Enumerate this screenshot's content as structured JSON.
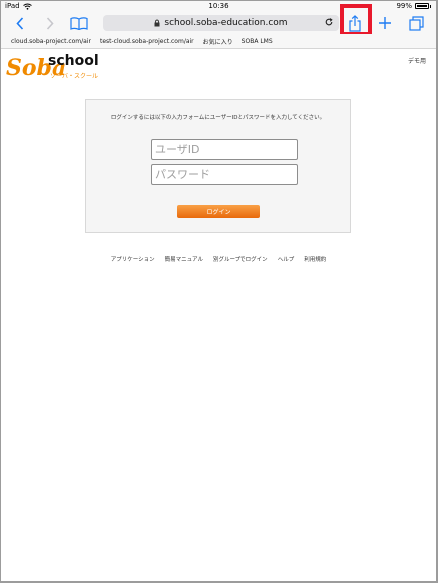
{
  "status_bar": {
    "device": "iPad",
    "time": "10:36",
    "battery": "99%"
  },
  "toolbar": {
    "url": "school.soba-education.com",
    "icons": {
      "back": "chevron-left-icon",
      "forward": "chevron-right-icon",
      "bookmarks": "book-icon",
      "reload": "reload-icon",
      "share": "share-icon",
      "new_tab": "plus-icon",
      "tabs": "tabs-icon"
    }
  },
  "bookmarks": [
    "cloud.soba-project.com/air",
    "test-cloud.soba-project.com/air",
    "お気に入り",
    "SOBA LMS"
  ],
  "logo": {
    "soba": "Soba",
    "school": "school",
    "sub": "ソーバ・スクール"
  },
  "demo_label": "デモ用",
  "login": {
    "message": "ログインするには以下の入力フォームにユーザーIDとパスワードを入力してください。",
    "user_placeholder": "ユーザID",
    "password_placeholder": "パスワード",
    "button": "ログイン"
  },
  "footer_links": [
    "アプリケーション",
    "簡易マニュアル",
    "別グループでログイン",
    "ヘルプ",
    "利用規約"
  ],
  "colors": {
    "accent": "#1e7cf3",
    "brand_orange": "#f08a00",
    "highlight": "#e8192c"
  }
}
